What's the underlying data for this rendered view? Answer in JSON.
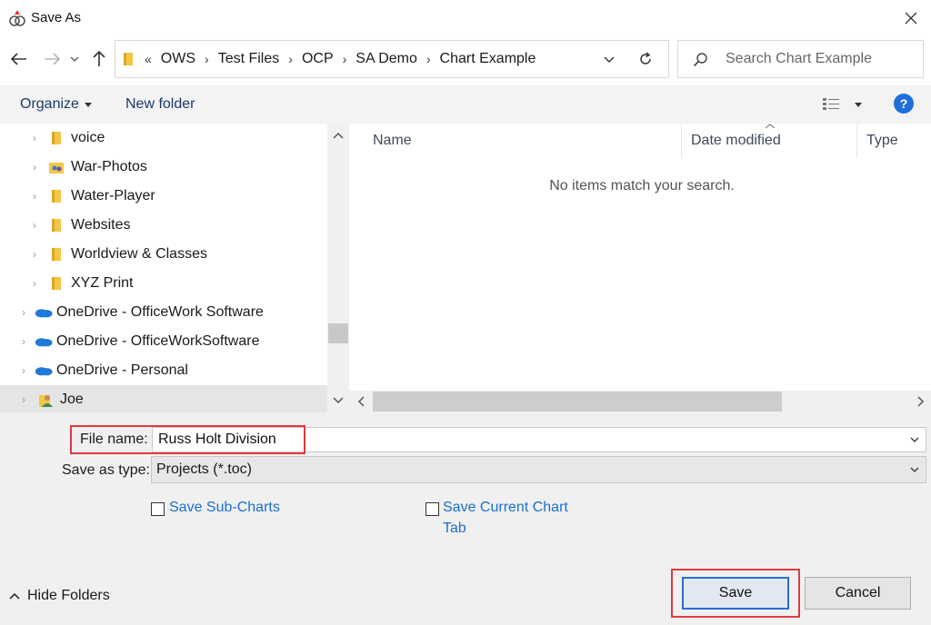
{
  "window": {
    "title": "Save As"
  },
  "address": {
    "overflow": "«",
    "crumbs": [
      "OWS",
      "Test Files",
      "OCP",
      "SA Demo",
      "Chart Example"
    ]
  },
  "search": {
    "placeholder": "Search Chart Example"
  },
  "toolbar": {
    "organize_label": "Organize",
    "new_folder_label": "New folder",
    "help_label": "?"
  },
  "nav": {
    "items": [
      {
        "label": "voice",
        "icon": "folder-icon"
      },
      {
        "label": "War-Photos",
        "icon": "folder-people-icon"
      },
      {
        "label": "Water-Player",
        "icon": "folder-icon"
      },
      {
        "label": "Websites",
        "icon": "folder-icon"
      },
      {
        "label": "Worldview & Classes",
        "icon": "folder-icon"
      },
      {
        "label": "XYZ Print",
        "icon": "folder-icon"
      },
      {
        "label": "OneDrive - OfficeWork Software",
        "icon": "onedrive-icon"
      },
      {
        "label": "OneDrive - OfficeWorkSoftware",
        "icon": "onedrive-icon"
      },
      {
        "label": "OneDrive - Personal",
        "icon": "onedrive-icon"
      },
      {
        "label": "Joe",
        "icon": "user-folder-icon"
      }
    ]
  },
  "files": {
    "columns": [
      "Name",
      "Date modified",
      "Type"
    ],
    "empty_message": "No items match your search."
  },
  "form": {
    "file_name_label": "File name:",
    "file_name_value": "Russ Holt Division",
    "save_as_type_label": "Save as type:",
    "save_as_type_value": "Projects (*.toc)",
    "save_sub_charts_label": "Save Sub-Charts",
    "save_current_tab_line1": "Save Current Chart",
    "save_current_tab_line2": "Tab"
  },
  "buttons": {
    "hide_folders": "Hide Folders",
    "save": "Save",
    "cancel": "Cancel"
  },
  "colors": {
    "accent": "#2a6ed1",
    "highlight": "#e0393e",
    "folder": "#f2c744",
    "onedrive": "#1e7ad8",
    "link": "#1a6fcf"
  }
}
